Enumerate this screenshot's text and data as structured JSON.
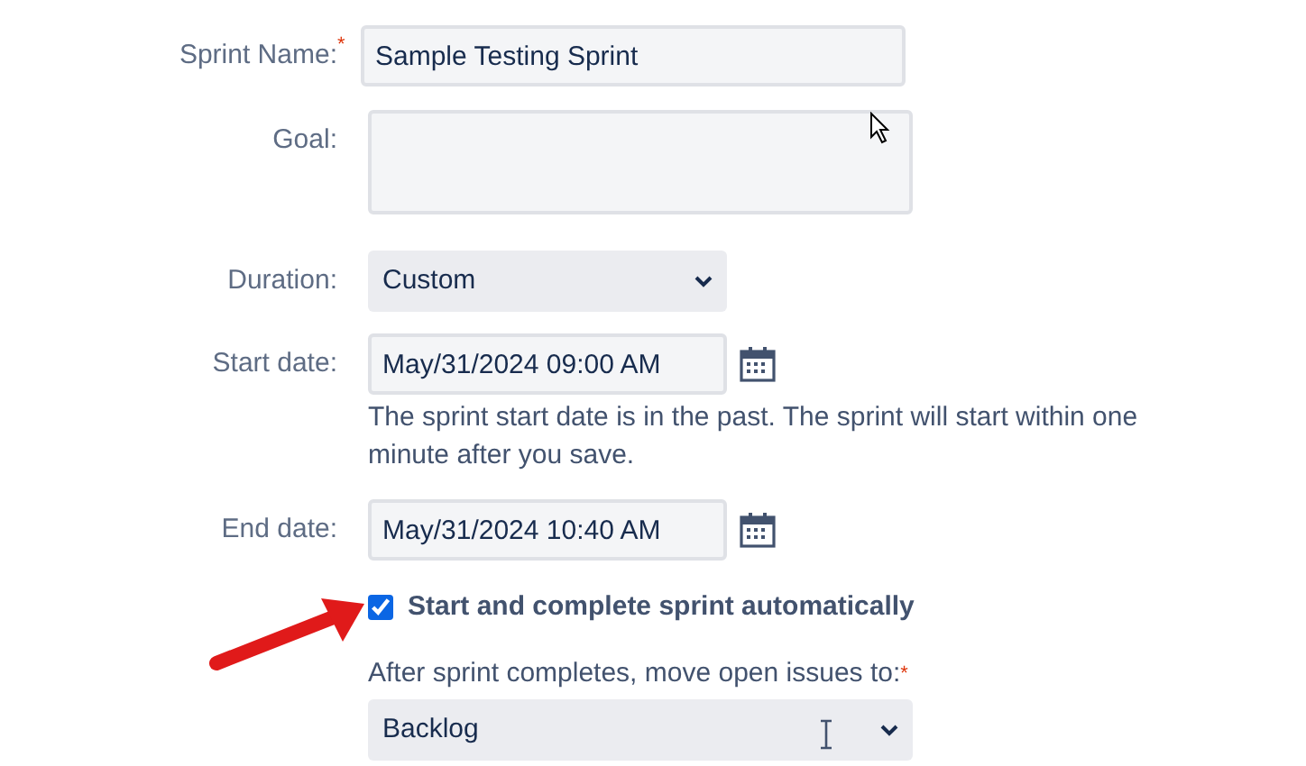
{
  "fields": [
    {
      "kind": "text",
      "label": "Sprint Name:",
      "required_mark": "*",
      "value": "Sample Testing Sprint"
    },
    {
      "kind": "textarea",
      "label": "Goal:"
    },
    {
      "kind": "select",
      "label": "Duration:",
      "value": "Custom"
    },
    {
      "kind": "date",
      "label": "Start date:",
      "value": "May/31/2024 09:00 AM",
      "help": "The sprint start date is in the past. The sprint will start within one minute after you save."
    },
    {
      "kind": "date",
      "label": "End date:",
      "value": "May/31/2024 10:40 AM"
    }
  ],
  "auto_checkbox": {
    "label": "Start and complete sprint automatically",
    "checked": true
  },
  "move_issues": {
    "label": "After sprint completes, move open issues to:",
    "required_mark": "*",
    "value": "Backlog"
  }
}
